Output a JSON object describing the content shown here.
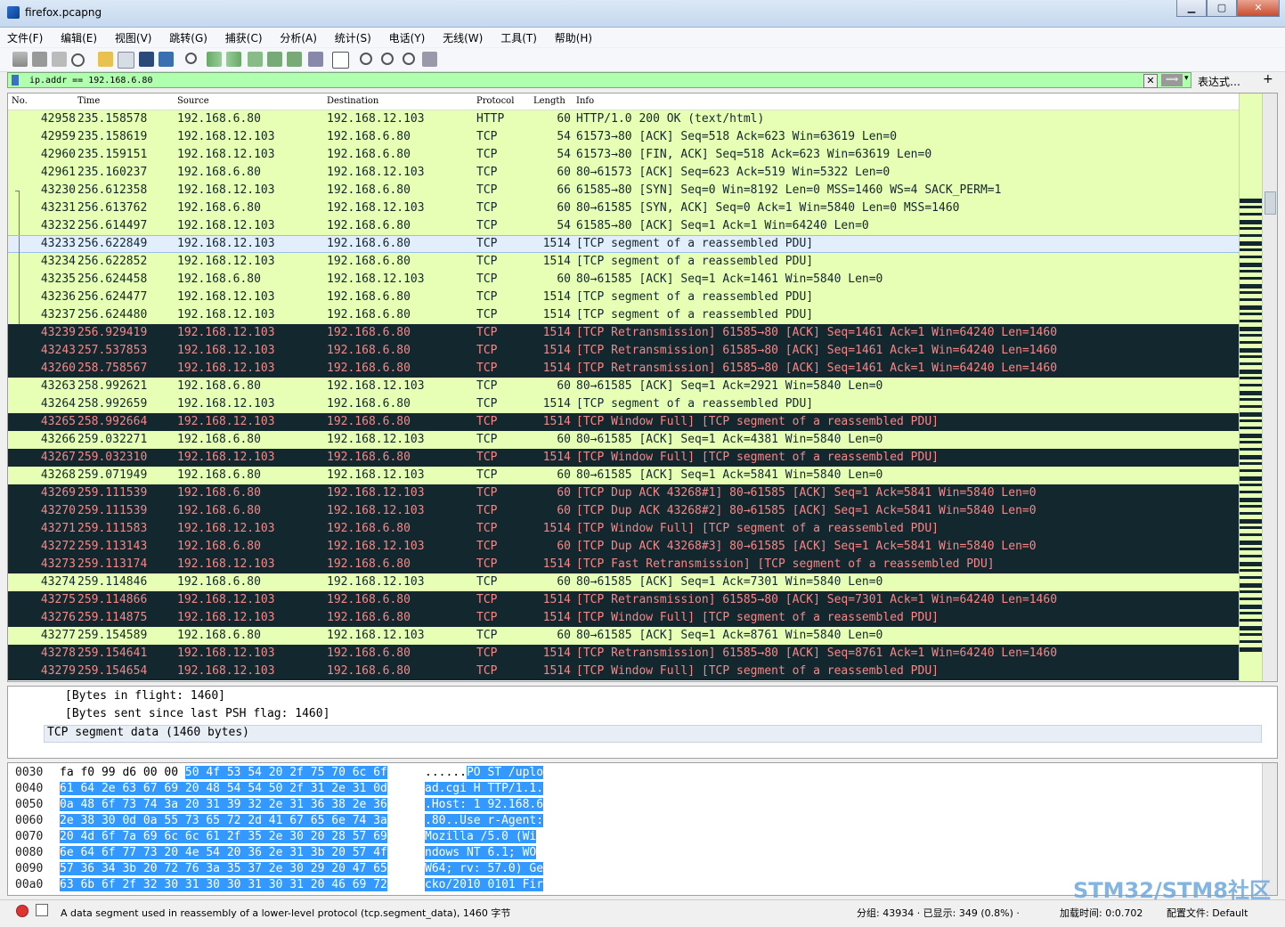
{
  "window": {
    "title": "firefox.pcapng",
    "min": "▁",
    "max": "▢",
    "close": "✕"
  },
  "menu": [
    "文件(F)",
    "编辑(E)",
    "视图(V)",
    "跳转(G)",
    "捕获(C)",
    "分析(A)",
    "统计(S)",
    "电话(Y)",
    "无线(W)",
    "工具(T)",
    "帮助(H)"
  ],
  "filter": {
    "value": "ip.addr == 192.168.6.80",
    "clear": "✕",
    "apply": "⟹",
    "dropdown": "▾",
    "expression": "表达式…",
    "add": "+"
  },
  "columns": {
    "no": "No.",
    "time": "Time",
    "source": "Source",
    "destination": "Destination",
    "protocol": "Protocol",
    "length": "Length",
    "info": "Info"
  },
  "packets": [
    {
      "no": "42958",
      "time": "235.158578",
      "src": "192.168.6.80",
      "dst": "192.168.12.103",
      "proto": "HTTP",
      "len": "60",
      "info": "HTTP/1.0 200 OK  (text/html)",
      "style": "ok"
    },
    {
      "no": "42959",
      "time": "235.158619",
      "src": "192.168.12.103",
      "dst": "192.168.6.80",
      "proto": "TCP",
      "len": "54",
      "info": "61573→80 [ACK] Seq=518 Ack=623 Win=63619 Len=0",
      "style": "ok"
    },
    {
      "no": "42960",
      "time": "235.159151",
      "src": "192.168.12.103",
      "dst": "192.168.6.80",
      "proto": "TCP",
      "len": "54",
      "info": "61573→80 [FIN, ACK] Seq=518 Ack=623 Win=63619 Len=0",
      "style": "ok"
    },
    {
      "no": "42961",
      "time": "235.160237",
      "src": "192.168.6.80",
      "dst": "192.168.12.103",
      "proto": "TCP",
      "len": "60",
      "info": "80→61573 [ACK] Seq=623 Ack=519 Win=5322 Len=0",
      "style": "ok"
    },
    {
      "no": "43230",
      "time": "256.612358",
      "src": "192.168.12.103",
      "dst": "192.168.6.80",
      "proto": "TCP",
      "len": "66",
      "info": "61585→80 [SYN] Seq=0 Win=8192 Len=0 MSS=1460 WS=4 SACK_PERM=1",
      "style": "ok",
      "conv": "start"
    },
    {
      "no": "43231",
      "time": "256.613762",
      "src": "192.168.6.80",
      "dst": "192.168.12.103",
      "proto": "TCP",
      "len": "60",
      "info": "80→61585 [SYN, ACK] Seq=0 Ack=1 Win=5840 Len=0 MSS=1460",
      "style": "ok",
      "conv": "mid"
    },
    {
      "no": "43232",
      "time": "256.614497",
      "src": "192.168.12.103",
      "dst": "192.168.6.80",
      "proto": "TCP",
      "len": "54",
      "info": "61585→80 [ACK] Seq=1 Ack=1 Win=64240 Len=0",
      "style": "ok",
      "conv": "mid"
    },
    {
      "no": "43233",
      "time": "256.622849",
      "src": "192.168.12.103",
      "dst": "192.168.6.80",
      "proto": "TCP",
      "len": "1514",
      "info": "[TCP segment of a reassembled PDU]",
      "style": "selected",
      "conv": "mid"
    },
    {
      "no": "43234",
      "time": "256.622852",
      "src": "192.168.12.103",
      "dst": "192.168.6.80",
      "proto": "TCP",
      "len": "1514",
      "info": "[TCP segment of a reassembled PDU]",
      "style": "ok",
      "conv": "mid"
    },
    {
      "no": "43235",
      "time": "256.624458",
      "src": "192.168.6.80",
      "dst": "192.168.12.103",
      "proto": "TCP",
      "len": "60",
      "info": "80→61585 [ACK] Seq=1 Ack=1461 Win=5840 Len=0",
      "style": "ok",
      "conv": "mid"
    },
    {
      "no": "43236",
      "time": "256.624477",
      "src": "192.168.12.103",
      "dst": "192.168.6.80",
      "proto": "TCP",
      "len": "1514",
      "info": "[TCP segment of a reassembled PDU]",
      "style": "ok",
      "conv": "mid"
    },
    {
      "no": "43237",
      "time": "256.624480",
      "src": "192.168.12.103",
      "dst": "192.168.6.80",
      "proto": "TCP",
      "len": "1514",
      "info": "[TCP segment of a reassembled PDU]",
      "style": "ok",
      "conv": "mid"
    },
    {
      "no": "43239",
      "time": "256.929419",
      "src": "192.168.12.103",
      "dst": "192.168.6.80",
      "proto": "TCP",
      "len": "1514",
      "info": "[TCP Retransmission] 61585→80 [ACK] Seq=1461 Ack=1 Win=64240 Len=1460",
      "style": "bad"
    },
    {
      "no": "43243",
      "time": "257.537853",
      "src": "192.168.12.103",
      "dst": "192.168.6.80",
      "proto": "TCP",
      "len": "1514",
      "info": "[TCP Retransmission] 61585→80 [ACK] Seq=1461 Ack=1 Win=64240 Len=1460",
      "style": "bad"
    },
    {
      "no": "43260",
      "time": "258.758567",
      "src": "192.168.12.103",
      "dst": "192.168.6.80",
      "proto": "TCP",
      "len": "1514",
      "info": "[TCP Retransmission] 61585→80 [ACK] Seq=1461 Ack=1 Win=64240 Len=1460",
      "style": "bad"
    },
    {
      "no": "43263",
      "time": "258.992621",
      "src": "192.168.6.80",
      "dst": "192.168.12.103",
      "proto": "TCP",
      "len": "60",
      "info": "80→61585 [ACK] Seq=1 Ack=2921 Win=5840 Len=0",
      "style": "ok"
    },
    {
      "no": "43264",
      "time": "258.992659",
      "src": "192.168.12.103",
      "dst": "192.168.6.80",
      "proto": "TCP",
      "len": "1514",
      "info": "[TCP segment of a reassembled PDU]",
      "style": "ok"
    },
    {
      "no": "43265",
      "time": "258.992664",
      "src": "192.168.12.103",
      "dst": "192.168.6.80",
      "proto": "TCP",
      "len": "1514",
      "info": "[TCP Window Full] [TCP segment of a reassembled PDU]",
      "style": "bad"
    },
    {
      "no": "43266",
      "time": "259.032271",
      "src": "192.168.6.80",
      "dst": "192.168.12.103",
      "proto": "TCP",
      "len": "60",
      "info": "80→61585 [ACK] Seq=1 Ack=4381 Win=5840 Len=0",
      "style": "ok"
    },
    {
      "no": "43267",
      "time": "259.032310",
      "src": "192.168.12.103",
      "dst": "192.168.6.80",
      "proto": "TCP",
      "len": "1514",
      "info": "[TCP Window Full] [TCP segment of a reassembled PDU]",
      "style": "bad"
    },
    {
      "no": "43268",
      "time": "259.071949",
      "src": "192.168.6.80",
      "dst": "192.168.12.103",
      "proto": "TCP",
      "len": "60",
      "info": "80→61585 [ACK] Seq=1 Ack=5841 Win=5840 Len=0",
      "style": "ok"
    },
    {
      "no": "43269",
      "time": "259.111539",
      "src": "192.168.6.80",
      "dst": "192.168.12.103",
      "proto": "TCP",
      "len": "60",
      "info": "[TCP Dup ACK 43268#1] 80→61585 [ACK] Seq=1 Ack=5841 Win=5840 Len=0",
      "style": "bad"
    },
    {
      "no": "43270",
      "time": "259.111539",
      "src": "192.168.6.80",
      "dst": "192.168.12.103",
      "proto": "TCP",
      "len": "60",
      "info": "[TCP Dup ACK 43268#2] 80→61585 [ACK] Seq=1 Ack=5841 Win=5840 Len=0",
      "style": "bad"
    },
    {
      "no": "43271",
      "time": "259.111583",
      "src": "192.168.12.103",
      "dst": "192.168.6.80",
      "proto": "TCP",
      "len": "1514",
      "info": "[TCP Window Full] [TCP segment of a reassembled PDU]",
      "style": "bad"
    },
    {
      "no": "43272",
      "time": "259.113143",
      "src": "192.168.6.80",
      "dst": "192.168.12.103",
      "proto": "TCP",
      "len": "60",
      "info": "[TCP Dup ACK 43268#3] 80→61585 [ACK] Seq=1 Ack=5841 Win=5840 Len=0",
      "style": "bad"
    },
    {
      "no": "43273",
      "time": "259.113174",
      "src": "192.168.12.103",
      "dst": "192.168.6.80",
      "proto": "TCP",
      "len": "1514",
      "info": "[TCP Fast Retransmission] [TCP segment of a reassembled PDU]",
      "style": "bad"
    },
    {
      "no": "43274",
      "time": "259.114846",
      "src": "192.168.6.80",
      "dst": "192.168.12.103",
      "proto": "TCP",
      "len": "60",
      "info": "80→61585 [ACK] Seq=1 Ack=7301 Win=5840 Len=0",
      "style": "ok"
    },
    {
      "no": "43275",
      "time": "259.114866",
      "src": "192.168.12.103",
      "dst": "192.168.6.80",
      "proto": "TCP",
      "len": "1514",
      "info": "[TCP Retransmission] 61585→80 [ACK] Seq=7301 Ack=1 Win=64240 Len=1460",
      "style": "bad"
    },
    {
      "no": "43276",
      "time": "259.114875",
      "src": "192.168.12.103",
      "dst": "192.168.6.80",
      "proto": "TCP",
      "len": "1514",
      "info": "[TCP Window Full] [TCP segment of a reassembled PDU]",
      "style": "bad"
    },
    {
      "no": "43277",
      "time": "259.154589",
      "src": "192.168.6.80",
      "dst": "192.168.12.103",
      "proto": "TCP",
      "len": "60",
      "info": "80→61585 [ACK] Seq=1 Ack=8761 Win=5840 Len=0",
      "style": "ok"
    },
    {
      "no": "43278",
      "time": "259.154641",
      "src": "192.168.12.103",
      "dst": "192.168.6.80",
      "proto": "TCP",
      "len": "1514",
      "info": "[TCP Retransmission] 61585→80 [ACK] Seq=8761 Ack=1 Win=64240 Len=1460",
      "style": "bad"
    },
    {
      "no": "43279",
      "time": "259.154654",
      "src": "192.168.12.103",
      "dst": "192.168.6.80",
      "proto": "TCP",
      "len": "1514",
      "info": "[TCP Window Full] [TCP segment of a reassembled PDU]",
      "style": "bad"
    }
  ],
  "details": [
    "[Bytes in flight: 1460]",
    "[Bytes sent since last PSH flag: 1460]",
    "TCP segment data (1460 bytes)"
  ],
  "bytes": [
    {
      "off": "0030",
      "pre": "fa f0 99 d6 00 00 ",
      "hl": "50 4f  53 54 20 2f 75 70 6c 6f",
      "apre": "......",
      "ahl": "PO ST /uplo"
    },
    {
      "off": "0040",
      "pre": "",
      "hl": "61 64 2e 63 67 69 20 48  54 54 50 2f 31 2e 31 0d",
      "apre": "",
      "ahl": "ad.cgi H TTP/1.1."
    },
    {
      "off": "0050",
      "pre": "",
      "hl": "0a 48 6f 73 74 3a 20 31  39 32 2e 31 36 38 2e 36",
      "apre": "",
      "ahl": ".Host: 1 92.168.6"
    },
    {
      "off": "0060",
      "pre": "",
      "hl": "2e 38 30 0d 0a 55 73 65  72 2d 41 67 65 6e 74 3a",
      "apre": "",
      "ahl": ".80..Use r-Agent:"
    },
    {
      "off": "0070",
      "pre": "",
      "hl": "20 4d 6f 7a 69 6c 6c 61  2f 35 2e 30 20 28 57 69",
      "apre": "",
      "ahl": " Mozilla /5.0 (Wi"
    },
    {
      "off": "0080",
      "pre": "",
      "hl": "6e 64 6f 77 73 20 4e 54  20 36 2e 31 3b 20 57 4f",
      "apre": "",
      "ahl": "ndows NT  6.1; WO"
    },
    {
      "off": "0090",
      "pre": "",
      "hl": "57 36 34 3b 20 72 76 3a  35 37 2e 30 29 20 47 65",
      "apre": "",
      "ahl": "W64; rv: 57.0) Ge"
    },
    {
      "off": "00a0",
      "pre": "",
      "hl": "63 6b 6f 2f 32 30 31 30  30 31 30 31 20 46 69 72",
      "apre": "",
      "ahl": "cko/2010 0101 Fir"
    }
  ],
  "status": {
    "message": "A data segment used in reassembly of a lower-level protocol (tcp.segment_data), 1460 字节",
    "packets": "分组: 43934 · 已显示: 349 (0.8%) ·",
    "load_time": "加载时间: 0:0.702",
    "profile": "配置文件: Default"
  },
  "watermark": "STM32/STM8社区",
  "colors": {
    "ok_bg": "#e7ffb4",
    "bad_bg": "#12272e",
    "bad_fg": "#f78787",
    "filter_bg": "#afffaf",
    "selection": "#3399ff"
  }
}
